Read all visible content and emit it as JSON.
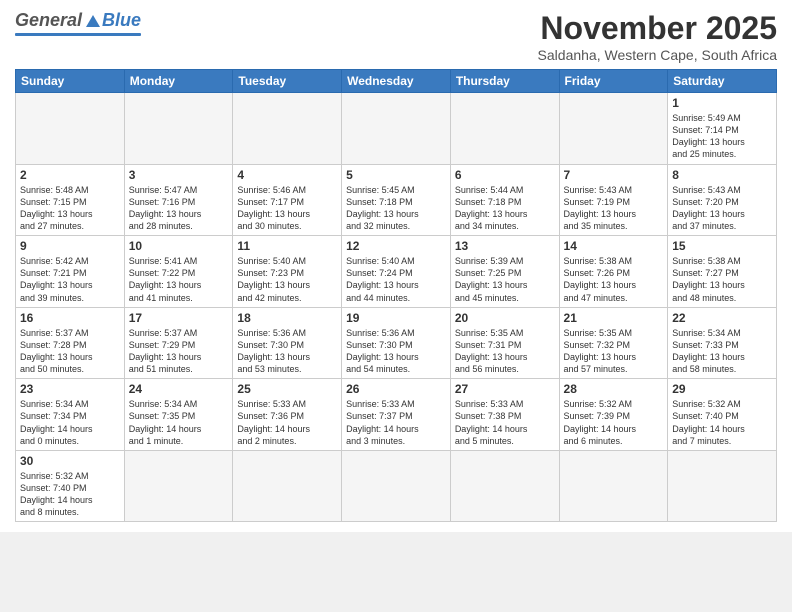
{
  "header": {
    "logo_general": "General",
    "logo_blue": "Blue",
    "title": "November 2025",
    "subtitle": "Saldanha, Western Cape, South Africa"
  },
  "weekdays": [
    "Sunday",
    "Monday",
    "Tuesday",
    "Wednesday",
    "Thursday",
    "Friday",
    "Saturday"
  ],
  "weeks": [
    [
      {
        "day": "",
        "info": ""
      },
      {
        "day": "",
        "info": ""
      },
      {
        "day": "",
        "info": ""
      },
      {
        "day": "",
        "info": ""
      },
      {
        "day": "",
        "info": ""
      },
      {
        "day": "",
        "info": ""
      },
      {
        "day": "1",
        "info": "Sunrise: 5:49 AM\nSunset: 7:14 PM\nDaylight: 13 hours\nand 25 minutes."
      }
    ],
    [
      {
        "day": "2",
        "info": "Sunrise: 5:48 AM\nSunset: 7:15 PM\nDaylight: 13 hours\nand 27 minutes."
      },
      {
        "day": "3",
        "info": "Sunrise: 5:47 AM\nSunset: 7:16 PM\nDaylight: 13 hours\nand 28 minutes."
      },
      {
        "day": "4",
        "info": "Sunrise: 5:46 AM\nSunset: 7:17 PM\nDaylight: 13 hours\nand 30 minutes."
      },
      {
        "day": "5",
        "info": "Sunrise: 5:45 AM\nSunset: 7:18 PM\nDaylight: 13 hours\nand 32 minutes."
      },
      {
        "day": "6",
        "info": "Sunrise: 5:44 AM\nSunset: 7:18 PM\nDaylight: 13 hours\nand 34 minutes."
      },
      {
        "day": "7",
        "info": "Sunrise: 5:43 AM\nSunset: 7:19 PM\nDaylight: 13 hours\nand 35 minutes."
      },
      {
        "day": "8",
        "info": "Sunrise: 5:43 AM\nSunset: 7:20 PM\nDaylight: 13 hours\nand 37 minutes."
      }
    ],
    [
      {
        "day": "9",
        "info": "Sunrise: 5:42 AM\nSunset: 7:21 PM\nDaylight: 13 hours\nand 39 minutes."
      },
      {
        "day": "10",
        "info": "Sunrise: 5:41 AM\nSunset: 7:22 PM\nDaylight: 13 hours\nand 41 minutes."
      },
      {
        "day": "11",
        "info": "Sunrise: 5:40 AM\nSunset: 7:23 PM\nDaylight: 13 hours\nand 42 minutes."
      },
      {
        "day": "12",
        "info": "Sunrise: 5:40 AM\nSunset: 7:24 PM\nDaylight: 13 hours\nand 44 minutes."
      },
      {
        "day": "13",
        "info": "Sunrise: 5:39 AM\nSunset: 7:25 PM\nDaylight: 13 hours\nand 45 minutes."
      },
      {
        "day": "14",
        "info": "Sunrise: 5:38 AM\nSunset: 7:26 PM\nDaylight: 13 hours\nand 47 minutes."
      },
      {
        "day": "15",
        "info": "Sunrise: 5:38 AM\nSunset: 7:27 PM\nDaylight: 13 hours\nand 48 minutes."
      }
    ],
    [
      {
        "day": "16",
        "info": "Sunrise: 5:37 AM\nSunset: 7:28 PM\nDaylight: 13 hours\nand 50 minutes."
      },
      {
        "day": "17",
        "info": "Sunrise: 5:37 AM\nSunset: 7:29 PM\nDaylight: 13 hours\nand 51 minutes."
      },
      {
        "day": "18",
        "info": "Sunrise: 5:36 AM\nSunset: 7:30 PM\nDaylight: 13 hours\nand 53 minutes."
      },
      {
        "day": "19",
        "info": "Sunrise: 5:36 AM\nSunset: 7:30 PM\nDaylight: 13 hours\nand 54 minutes."
      },
      {
        "day": "20",
        "info": "Sunrise: 5:35 AM\nSunset: 7:31 PM\nDaylight: 13 hours\nand 56 minutes."
      },
      {
        "day": "21",
        "info": "Sunrise: 5:35 AM\nSunset: 7:32 PM\nDaylight: 13 hours\nand 57 minutes."
      },
      {
        "day": "22",
        "info": "Sunrise: 5:34 AM\nSunset: 7:33 PM\nDaylight: 13 hours\nand 58 minutes."
      }
    ],
    [
      {
        "day": "23",
        "info": "Sunrise: 5:34 AM\nSunset: 7:34 PM\nDaylight: 14 hours\nand 0 minutes."
      },
      {
        "day": "24",
        "info": "Sunrise: 5:34 AM\nSunset: 7:35 PM\nDaylight: 14 hours\nand 1 minute."
      },
      {
        "day": "25",
        "info": "Sunrise: 5:33 AM\nSunset: 7:36 PM\nDaylight: 14 hours\nand 2 minutes."
      },
      {
        "day": "26",
        "info": "Sunrise: 5:33 AM\nSunset: 7:37 PM\nDaylight: 14 hours\nand 3 minutes."
      },
      {
        "day": "27",
        "info": "Sunrise: 5:33 AM\nSunset: 7:38 PM\nDaylight: 14 hours\nand 5 minutes."
      },
      {
        "day": "28",
        "info": "Sunrise: 5:32 AM\nSunset: 7:39 PM\nDaylight: 14 hours\nand 6 minutes."
      },
      {
        "day": "29",
        "info": "Sunrise: 5:32 AM\nSunset: 7:40 PM\nDaylight: 14 hours\nand 7 minutes."
      }
    ],
    [
      {
        "day": "30",
        "info": "Sunrise: 5:32 AM\nSunset: 7:40 PM\nDaylight: 14 hours\nand 8 minutes."
      },
      {
        "day": "",
        "info": ""
      },
      {
        "day": "",
        "info": ""
      },
      {
        "day": "",
        "info": ""
      },
      {
        "day": "",
        "info": ""
      },
      {
        "day": "",
        "info": ""
      },
      {
        "day": "",
        "info": ""
      }
    ]
  ]
}
